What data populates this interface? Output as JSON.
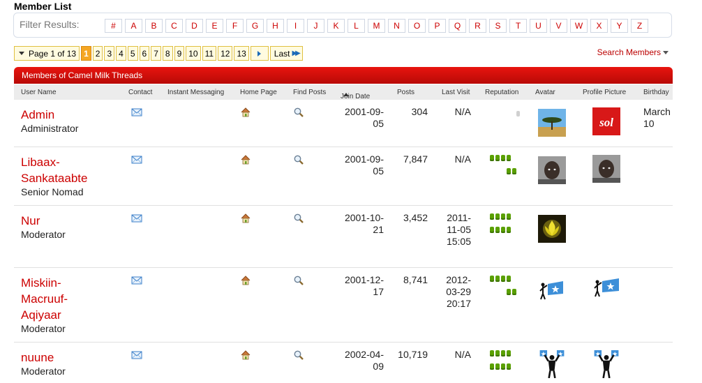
{
  "page_title": "Member List",
  "filter": {
    "label": "Filter Results:",
    "letters": [
      "#",
      "A",
      "B",
      "C",
      "D",
      "E",
      "F",
      "G",
      "H",
      "I",
      "J",
      "K",
      "L",
      "M",
      "N",
      "O",
      "P",
      "Q",
      "R",
      "S",
      "T",
      "U",
      "V",
      "W",
      "X",
      "Y",
      "Z"
    ]
  },
  "pager": {
    "label": "Page 1 of 13",
    "current": "1",
    "pages": [
      "2",
      "3",
      "4",
      "5",
      "6",
      "7",
      "8",
      "9",
      "10",
      "11",
      "12",
      "13"
    ],
    "last_label": "Last"
  },
  "search_members": "Search Members",
  "table_title": "Members of Camel Milk Threads",
  "columns": {
    "user_name": "User Name",
    "contact": "Contact",
    "instant_messaging": "Instant Messaging",
    "home_page": "Home Page",
    "find_posts": "Find Posts",
    "join_date": "Join Date",
    "posts": "Posts",
    "last_visit": "Last Visit",
    "reputation": "Reputation",
    "avatar": "Avatar",
    "profile_picture": "Profile Picture",
    "birthday": "Birthday"
  },
  "members": [
    {
      "name": "Admin",
      "title": "Administrator",
      "join_line1": "2001-09-",
      "join_line2": "05",
      "posts": "304",
      "last_visit_1": "N/A",
      "last_visit_2": "",
      "last_visit_3": "",
      "reputation_pips": 0,
      "birthday_1": "March",
      "birthday_2": "10",
      "avatar": "tree-avatar",
      "profile": "sol-logo"
    },
    {
      "name": "Libaax-Sankataabte",
      "title": "Senior Nomad",
      "join_line1": "2001-09-",
      "join_line2": "05",
      "posts": "7,847",
      "last_visit_1": "N/A",
      "last_visit_2": "",
      "last_visit_3": "",
      "reputation_pips": 6,
      "birthday_1": "",
      "birthday_2": "",
      "avatar": "child-photo",
      "profile": "child-photo"
    },
    {
      "name": "Nur",
      "title": "Moderator",
      "join_line1": "2001-10-",
      "join_line2": "21",
      "posts": "3,452",
      "last_visit_1": "2011-",
      "last_visit_2": "11-05",
      "last_visit_3": "15:05",
      "reputation_pips": 8,
      "birthday_1": "",
      "birthday_2": "",
      "avatar": "lotus-avatar",
      "profile": ""
    },
    {
      "name": "Miskiin-Macruuf-Aqiyaar",
      "title": "Moderator",
      "join_line1": "2001-12-",
      "join_line2": "17",
      "posts": "8,741",
      "last_visit_1": "2012-",
      "last_visit_2": "03-29",
      "last_visit_3": "20:17",
      "reputation_pips": 6,
      "birthday_1": "",
      "birthday_2": "",
      "avatar": "flag-figure",
      "profile": "flag-figure"
    },
    {
      "name": "nuune",
      "title": "Moderator",
      "join_line1": "2002-04-",
      "join_line2": "09",
      "posts": "10,719",
      "last_visit_1": "N/A",
      "last_visit_2": "",
      "last_visit_3": "",
      "reputation_pips": 8,
      "birthday_1": "",
      "birthday_2": "",
      "avatar": "flags-men",
      "profile": "flags-men"
    }
  ],
  "colors": {
    "accent_red": "#cc0000",
    "header_red": "#d40f0a",
    "pager_current": "#f5a623",
    "rep_green": "#5aa000"
  }
}
